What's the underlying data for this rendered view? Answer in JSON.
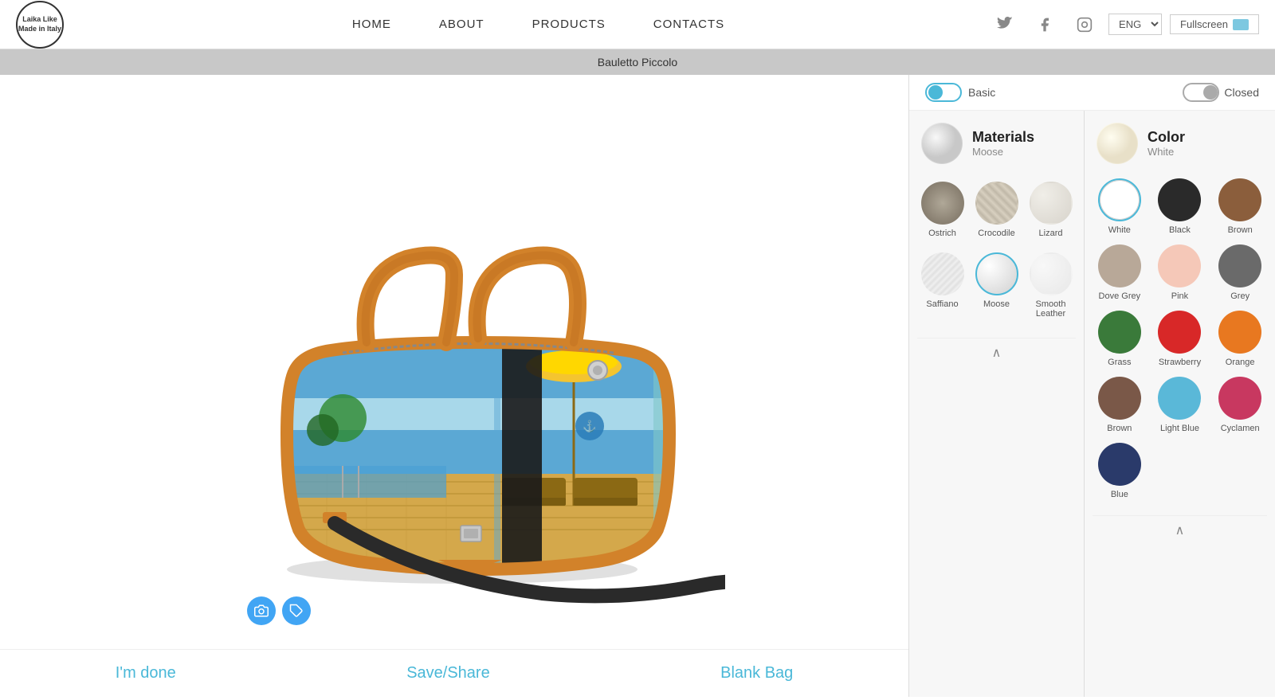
{
  "header": {
    "logo_text": "Laika Like\nMade in Italy",
    "nav": [
      {
        "label": "HOME",
        "id": "home"
      },
      {
        "label": "ABOUT",
        "id": "about"
      },
      {
        "label": "PRODUCTS",
        "id": "products"
      },
      {
        "label": "CONTACTS",
        "id": "contacts"
      }
    ],
    "lang": "ENG",
    "fullscreen_label": "Fullscreen"
  },
  "product_title_bar": {
    "label": "Bauletto Piccolo"
  },
  "config_bar": {
    "toggle_label": "Basic",
    "closure_label": "Closed"
  },
  "materials_section": {
    "title": "Materials",
    "subtitle": "Moose",
    "items": [
      {
        "id": "ostrich",
        "label": "Ostrich"
      },
      {
        "id": "crocodile",
        "label": "Crocodile"
      },
      {
        "id": "lizard",
        "label": "Lizard"
      },
      {
        "id": "saffiano",
        "label": "Saffiano"
      },
      {
        "id": "moose",
        "label": "Moose",
        "selected": true
      },
      {
        "id": "smooth",
        "label": "Smooth Leather"
      }
    ]
  },
  "color_section": {
    "title": "Color",
    "subtitle": "White",
    "items": [
      {
        "id": "white",
        "label": "White",
        "selected": true
      },
      {
        "id": "black",
        "label": "Black"
      },
      {
        "id": "brown",
        "label": "Brown"
      },
      {
        "id": "dove-grey",
        "label": "Dove Grey"
      },
      {
        "id": "pink",
        "label": "Pink"
      },
      {
        "id": "grey",
        "label": "Grey"
      },
      {
        "id": "grass",
        "label": "Grass"
      },
      {
        "id": "strawberry",
        "label": "Strawberry"
      },
      {
        "id": "orange",
        "label": "Orange"
      },
      {
        "id": "brown-2",
        "label": "Brown"
      },
      {
        "id": "light-blue",
        "label": "Light Blue"
      },
      {
        "id": "cyclamen",
        "label": "Cyclamen"
      },
      {
        "id": "blue",
        "label": "Blue"
      }
    ]
  },
  "bottom_actions": {
    "done_label": "I'm done",
    "save_label": "Save/Share",
    "blank_label": "Blank Bag"
  },
  "icons": {
    "twitter": "🐦",
    "facebook": "f",
    "instagram": "📷",
    "camera": "📷",
    "tag": "🏷",
    "chevron_up": "∧"
  }
}
